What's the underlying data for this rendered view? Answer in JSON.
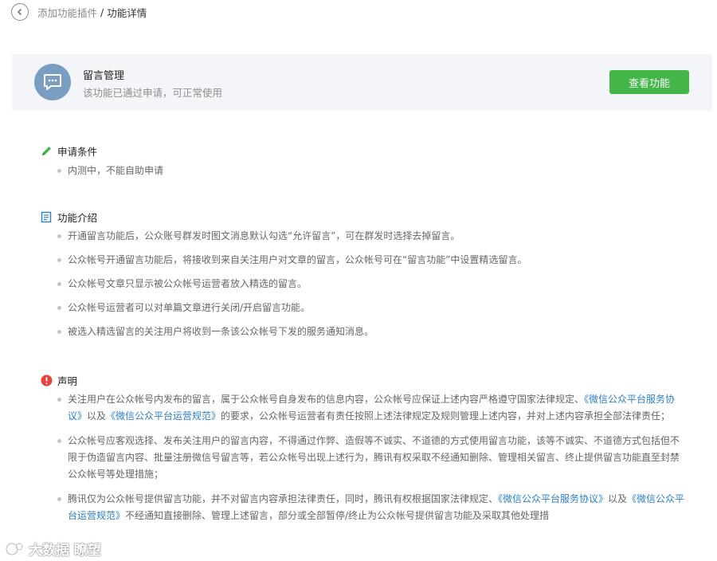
{
  "breadcrumb": {
    "parent": "添加功能插件",
    "separator": "/",
    "current": "功能详情"
  },
  "plugin": {
    "name": "留言管理",
    "status": "该功能已通过申请，可正常使用",
    "action_label": "查看功能",
    "avatar_color": "#7a9ec2",
    "action_color": "#44b549"
  },
  "sections": {
    "conditions": {
      "title": "申请条件",
      "icon": "pen-icon",
      "items": [
        "内测中，不能自助申请"
      ]
    },
    "intro": {
      "title": "功能介绍",
      "icon": "document-icon",
      "items": [
        "开通留言功能后，公众账号群发时图文消息默认勾选“允许留言”，可在群发时选择去掉留言。",
        "公众帐号开通留言功能后，将接收到来自关注用户对文章的留言，公众帐号可在“留言功能”中设置精选留言。",
        "公众帐号文章只显示被公众帐号运营者放入精选的留言。",
        "公众帐号运营者可以对单篇文章进行关闭/开启留言功能。",
        "被选入精选留言的关注用户将收到一条该公众帐号下发的服务通知消息。"
      ]
    },
    "declaration": {
      "title": "声明",
      "icon": "warning-icon",
      "items": [
        [
          {
            "text": "关注用户在公众帐号内发布的留言，属于公众帐号自身发布的信息内容，公众帐号应保证上述内容严格遵守国家法律规定、",
            "link": false
          },
          {
            "text": "《微信公众平台服务协议》",
            "link": true
          },
          {
            "text": "以及",
            "link": false
          },
          {
            "text": "《微信公众平台运营规范》",
            "link": true
          },
          {
            "text": "的要求，公众帐号运营者有责任按照上述法律规定及规则管理上述内容，并对上述内容承担全部法律责任；",
            "link": false
          }
        ],
        [
          {
            "text": "公众帐号应客观选择、发布关注用户的留言内容，不得通过作弊、造假等不诚实、不道德的方式使用留言功能，该等不诚实、不道德方式包括但不限于伪造留言内容、批量注册微信号留言等，若公众帐号出现上述行为，腾讯有权采取不经通知删除、管理相关留言、终止提供留言功能直至封禁公众帐号等处理措施；",
            "link": false
          }
        ],
        [
          {
            "text": "腾讯仅为公众帐号提供留言功能，并不对留言内容承担法律责任，同时，腾讯有权根据国家法律规定、",
            "link": false
          },
          {
            "text": "《微信公众平台服务协议》",
            "link": true
          },
          {
            "text": "以及",
            "link": false
          },
          {
            "text": "《微信公众平台运营规范》",
            "link": true
          },
          {
            "text": "不经通知直接删除、管理上述留言，部分或全部暂停/终止为公众帐号提供留言功能及采取其他处理措",
            "link": false
          }
        ]
      ]
    }
  },
  "watermark": {
    "text": "大数据 瞭望"
  },
  "colors": {
    "link": "#2d7fc2",
    "pen_icon": "#44b549",
    "document_icon": "#2d7fc2",
    "warning_icon": "#e64340"
  }
}
